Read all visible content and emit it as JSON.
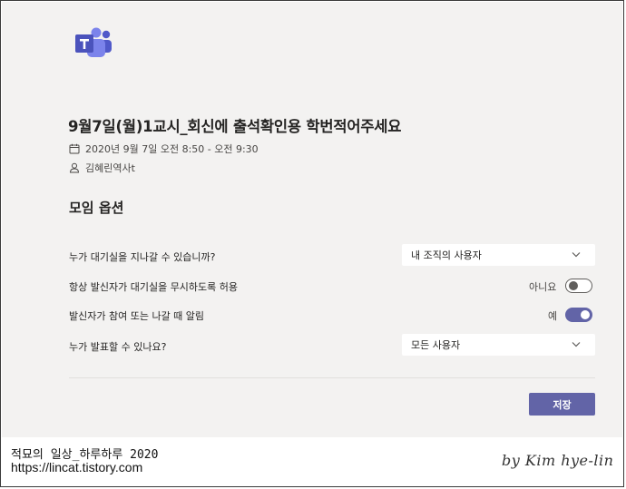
{
  "meeting": {
    "title": "9월7일(월)1교시_회신에 출석확인용 학번적어주세요",
    "datetime": "2020년 9월 7일 오전 8:50 - 오전 9:30",
    "organizer": "김혜린역사t"
  },
  "options": {
    "section_title": "모임 옵션",
    "lobby_label": "누가 대기실을 지나갈 수 있습니까?",
    "lobby_value": "내 조직의 사용자",
    "dialin_bypass_label": "항상 발신자가 대기실을 무시하도록 허용",
    "dialin_bypass_state": "아니요",
    "dialin_bypass_on": false,
    "join_leave_label": "발신자가 참여 또는 나갈 때 알림",
    "join_leave_state": "예",
    "join_leave_on": true,
    "presenter_label": "누가 발표할 수 있나요?",
    "presenter_value": "모든 사용자",
    "save_label": "저장"
  },
  "caption": {
    "line1": "적묘의 일상_하루하루 2020",
    "line2": "https://lincat.tistory.com",
    "signature": "by Kim hye-lin"
  },
  "icons": {
    "app_logo": "teams-logo-icon",
    "calendar": "calendar-icon",
    "person": "person-icon",
    "chevron": "chevron-down-icon"
  },
  "colors": {
    "accent": "#6264a7",
    "panel_background": "#f3f2f1",
    "text": "#252423"
  }
}
